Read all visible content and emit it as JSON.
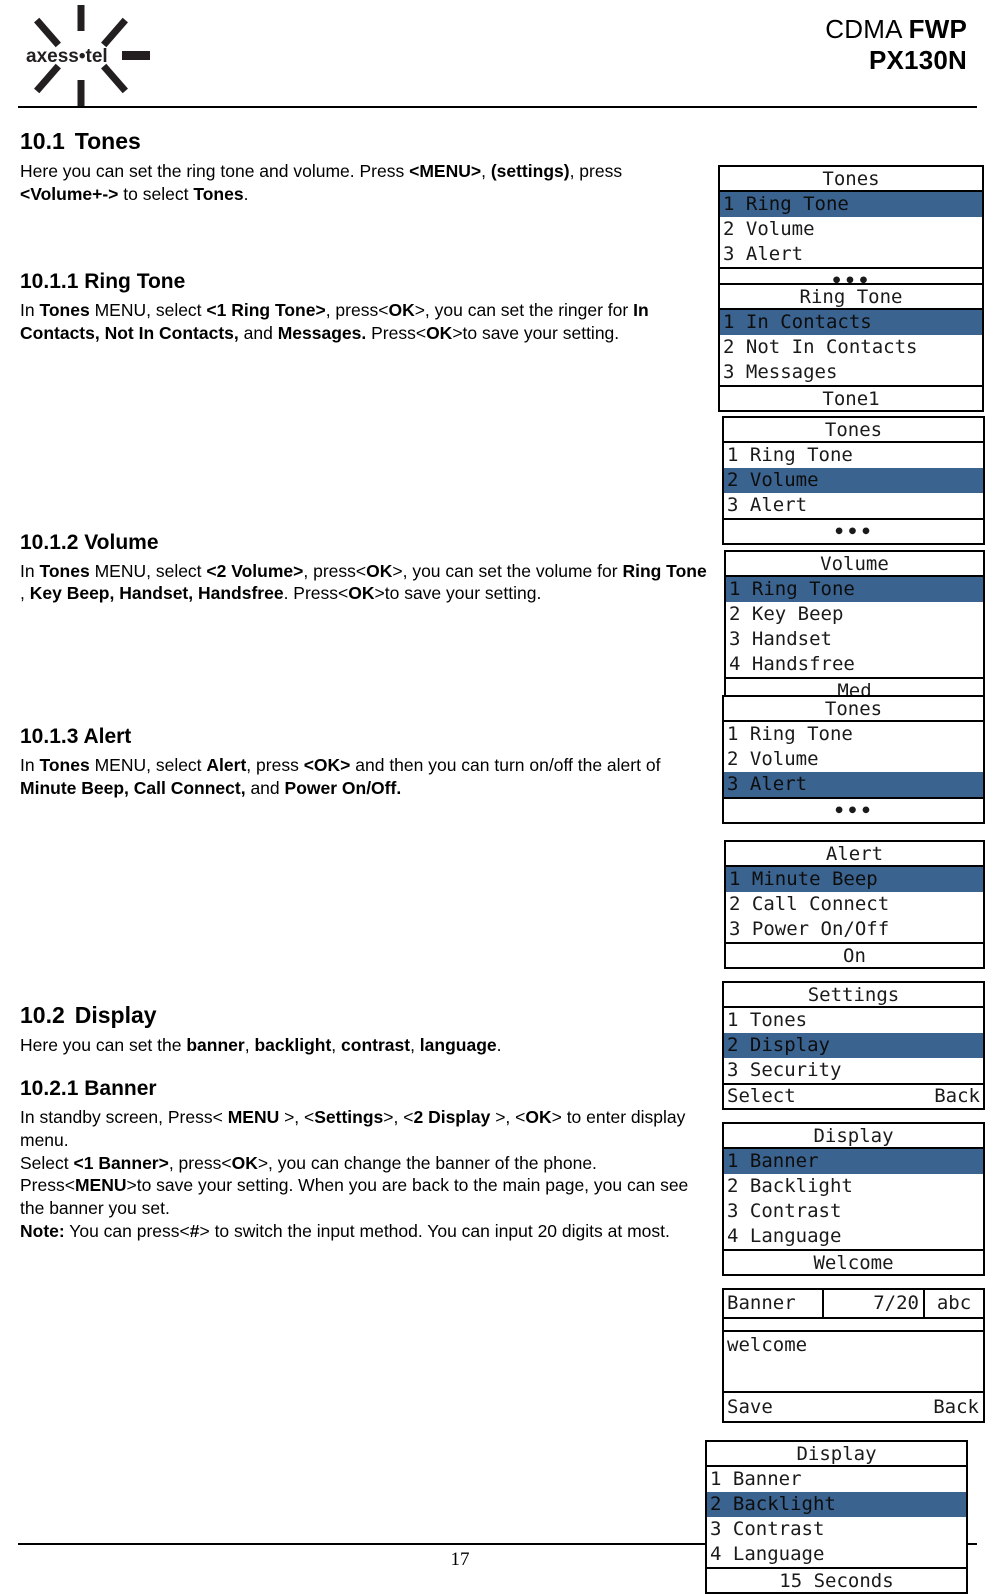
{
  "header": {
    "logo_name": "axess-tel",
    "logo_text": "axess•tel",
    "title_line1_light": "CDMA ",
    "title_line1_bold": "FWP",
    "title_line2": "PX130N"
  },
  "footer": {
    "page_number": "17"
  },
  "sections": {
    "tones": {
      "number": "10.1",
      "heading": "Tones",
      "body": "Here you can set the ring tone and volume. Press <MENU>, (settings), press <Volume+-> to select Tones."
    },
    "ring_tone": {
      "heading": "10.1.1 Ring Tone",
      "body": "In Tones MENU, select <1 Ring Tone>, press<OK>, you can set the ringer for In Contacts, Not In Contacts, and Messages. Press<OK>to save your setting."
    },
    "volume": {
      "heading": "10.1.2 Volume",
      "body": "In Tones MENU, select <2 Volume>, press<OK>, you can set the volume for Ring Tone , Key Beep, Handset, Handsfree. Press<OK>to save your setting."
    },
    "alert": {
      "heading": "10.1.3 Alert",
      "body": "In Tones MENU, select Alert, press <OK> and then you can turn on/off the alert of  Minute Beep, Call Connect, and Power On/Off."
    },
    "display": {
      "number": "10.2",
      "heading": "Display",
      "body": "Here you can set the banner, backlight, contrast, language."
    },
    "banner": {
      "heading": "10.2.1 Banner",
      "body_l1": "In standby screen, Press< MENU >, <Settings>, <2 Display >, <OK> to enter display menu.",
      "body_l2": "Select <1 Banner>, press<OK>, you can change the banner of the phone. Press<MENU>to save your setting. When you  are back to the main page, you can see the banner you set.",
      "body_note_label": "Note:",
      "body_note": " You can press<#> to switch the input method. You can input 20 digits at most."
    }
  },
  "colors": {
    "highlight": "#3a6390",
    "border": "#000000"
  },
  "screens": {
    "tones_1": {
      "title": "Tones",
      "items": [
        "1 Ring Tone",
        "2 Volume",
        "3 Alert"
      ],
      "selected": 0,
      "footer": "•••"
    },
    "ring_tone": {
      "title": "Ring Tone",
      "items": [
        "1 In Contacts",
        "2 Not In Contacts",
        "3 Messages"
      ],
      "selected": 0,
      "footer": "Tone1"
    },
    "tones_2": {
      "title": "Tones",
      "items": [
        "1 Ring Tone",
        "2 Volume",
        "3 Alert"
      ],
      "selected": 1,
      "footer": "•••"
    },
    "volume": {
      "title": "Volume",
      "items": [
        "1 Ring Tone",
        "2 Key Beep",
        "3 Handset",
        "4 Handsfree"
      ],
      "selected": 0,
      "footer": "Med"
    },
    "tones_3": {
      "title": "Tones",
      "items": [
        "1 Ring Tone",
        "2 Volume",
        "3 Alert"
      ],
      "selected": 2,
      "footer": "•••"
    },
    "alert": {
      "title": "Alert",
      "items": [
        "1 Minute Beep",
        "2 Call Connect",
        "3 Power On/Off"
      ],
      "selected": 0,
      "footer": "On"
    },
    "settings": {
      "title": "Settings",
      "items": [
        "1 Tones",
        "2 Display",
        "3 Security"
      ],
      "selected": 1,
      "softkey_left": "Select",
      "softkey_right": "Back"
    },
    "display_1": {
      "title": "Display",
      "items": [
        "1 Banner",
        "2 Backlight",
        "3 Contrast",
        "4 Language"
      ],
      "selected": 0,
      "footer": "Welcome"
    },
    "banner_editor": {
      "label": "Banner",
      "counter": "7/20",
      "input_mode": "abc",
      "text": "welcome",
      "softkey_left": "Save",
      "softkey_right": "Back"
    },
    "display_2": {
      "title": "Display",
      "items": [
        "1 Banner",
        "2 Backlight",
        "3 Contrast",
        "4 Language"
      ],
      "selected": 1,
      "footer": "15 Seconds"
    }
  }
}
